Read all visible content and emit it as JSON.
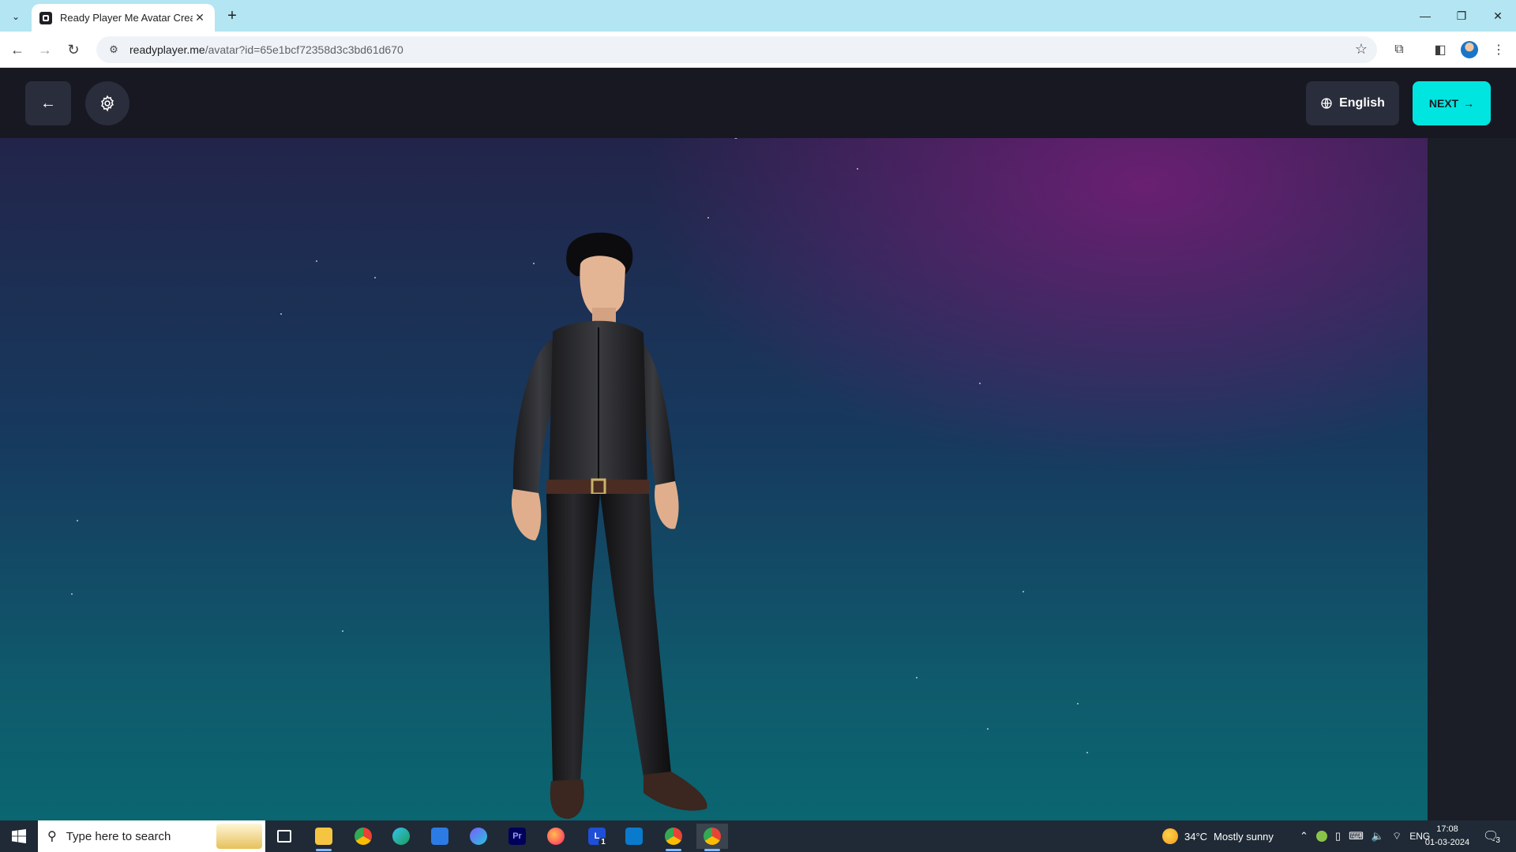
{
  "browser": {
    "tab_title": "Ready Player Me Avatar Creator",
    "url_host": "readyplayer.me",
    "url_path": "/avatar?id=65e1bcf72358d3c3bd61d670"
  },
  "app": {
    "back_icon": "←",
    "language_label": "English",
    "next_label": "NEXT",
    "next_arrow": "→"
  },
  "taskbar": {
    "search_placeholder": "Type here to search",
    "apps": [
      "task-view",
      "file-explorer",
      "chrome",
      "edge",
      "store",
      "copilot",
      "premiere-pro",
      "firefox",
      "l-app",
      "vscode",
      "chrome-profile-1",
      "chrome-profile-2"
    ],
    "l_badge": "1",
    "weather_temp": "34°C",
    "weather_desc": "Mostly sunny",
    "lang": "ENG",
    "time": "17:08",
    "date": "01-03-2024",
    "notif_count": "3"
  },
  "colors": {
    "accent": "#00e5e0",
    "header_bg": "#171821",
    "button_bg": "#2a2d3b",
    "tabbar": "#b3e5f2"
  }
}
